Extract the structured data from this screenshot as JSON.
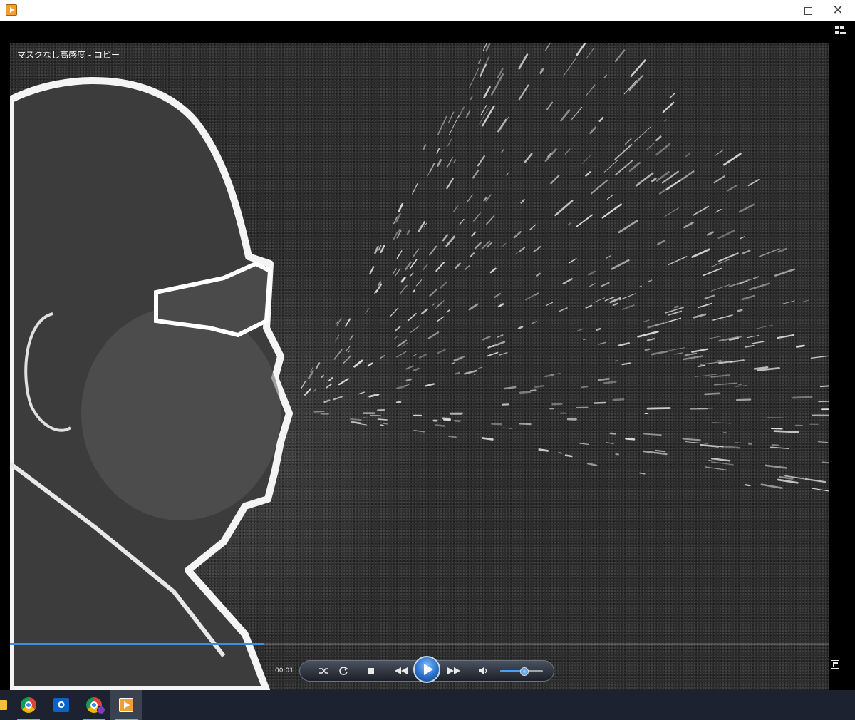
{
  "window": {
    "app_icon": "media-player-icon",
    "controls": {
      "minimize_icon": "minimize-icon",
      "maximize_icon": "maximize-icon",
      "close_icon": "close-icon"
    }
  },
  "player": {
    "video_title": "マスクなし高感度 - コピー",
    "current_time": "00:01",
    "seek_progress": 0.31,
    "volume_level": 0.55,
    "accent_color": "#3a8fe0",
    "buttons": [
      {
        "name": "shuffle-button",
        "icon": "shuffle-icon"
      },
      {
        "name": "repeat-button",
        "icon": "repeat-icon"
      },
      {
        "name": "stop-button",
        "icon": "stop-icon"
      },
      {
        "name": "previous-button",
        "icon": "previous-icon"
      },
      {
        "name": "play-button",
        "icon": "play-icon"
      },
      {
        "name": "next-button",
        "icon": "next-icon"
      },
      {
        "name": "mute-button",
        "icon": "speaker-icon"
      }
    ],
    "switch_view_icon": "switch-to-library-icon",
    "fullscreen_icon": "fullscreen-icon"
  },
  "taskbar": {
    "items": [
      {
        "name": "file-explorer",
        "icon": "folder-icon"
      },
      {
        "name": "chrome",
        "icon": "chrome-icon"
      },
      {
        "name": "outlook",
        "icon": "outlook-icon",
        "label": "O"
      },
      {
        "name": "chrome-profile",
        "icon": "chrome-icon"
      },
      {
        "name": "media-player",
        "icon": "media-player-icon",
        "active": true
      }
    ]
  }
}
